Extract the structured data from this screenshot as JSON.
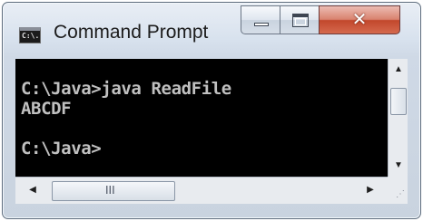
{
  "window": {
    "title": "Command Prompt",
    "icon_label": "C:\\.",
    "controls": {
      "minimize": "minimize-icon",
      "maximize": "maximize-icon",
      "close": "close-icon"
    }
  },
  "console": {
    "lines": [
      "C:\\Java>java ReadFile",
      "ABCDF",
      "",
      "C:\\Java>"
    ],
    "text_color": "#c0c0c0",
    "background": "#000000"
  },
  "scrollbars": {
    "vertical": {
      "up": "▲",
      "down": "▼"
    },
    "horizontal": {
      "left": "◀",
      "right": "▶",
      "grip": "III"
    }
  }
}
